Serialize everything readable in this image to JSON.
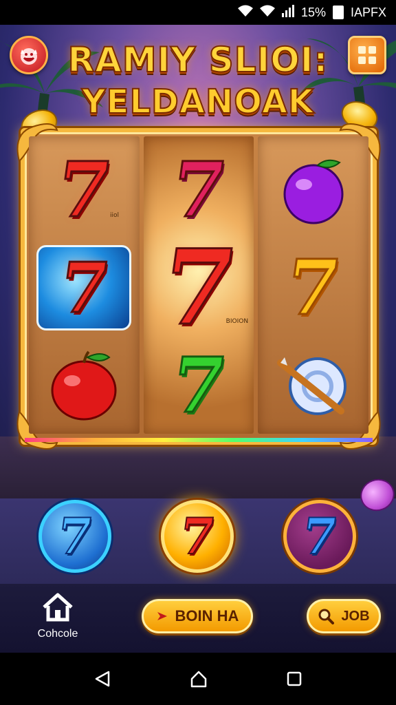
{
  "status_bar": {
    "battery_text": "15%",
    "right_text": "IAPFX",
    "icons": [
      "wifi-icon",
      "signal-icon",
      "battery-icon"
    ]
  },
  "game": {
    "title_line1": "RAMIY SLIOI:",
    "title_line2": "YELDANOAK",
    "reel_tiny_label_1": "iiol",
    "reel_tiny_label_2": "BIOION",
    "reels": [
      [
        "red-7",
        "blue-tile-7",
        "apple"
      ],
      [
        "pink-7",
        "big-red-7",
        "green-7"
      ],
      [
        "plum",
        "gold-7",
        "sword-shield"
      ]
    ],
    "colors": {
      "accent_gold": "#ffc11a",
      "frame": "#f6b83e",
      "bg_purple": "#2c2a6e"
    }
  },
  "controls": {
    "round_buttons": [
      "7",
      "7",
      "7"
    ],
    "home_label": "Cohcole",
    "spin_label": "BOIN HA",
    "search_label": "JOB"
  },
  "nav": {
    "icons": [
      "back-icon",
      "home-icon",
      "recents-icon"
    ]
  }
}
